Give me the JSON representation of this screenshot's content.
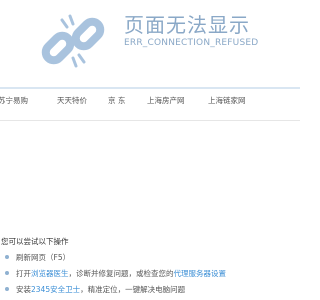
{
  "error": {
    "title": "页面无法显示",
    "code": "ERR_CONNECTION_REFUSED",
    "icon": "broken-link-icon",
    "accent_color": "#8aa8c7"
  },
  "quick_links": [
    "苏宁易购",
    "天天特价",
    "京 东",
    "上海房产网",
    "上海链家网"
  ],
  "suggestions": {
    "heading": "您可以尝试以下操作",
    "items": [
      {
        "pre": "刷新网页（F5）"
      },
      {
        "pre": "打开",
        "link": "浏览器医生",
        "mid": "，诊断并修复问题，或检查您的",
        "link2": "代理服务器设置"
      },
      {
        "pre": "安装",
        "link": "2345安全卫士",
        "mid": "，精准定位，一键解决电脑问题"
      }
    ],
    "link_color": "#3c8fd6"
  }
}
